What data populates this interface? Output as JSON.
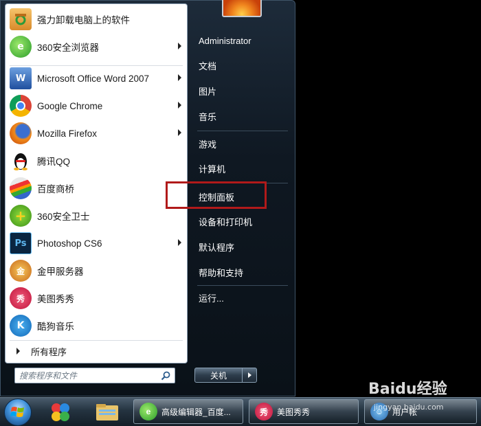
{
  "start_menu": {
    "programs": [
      {
        "label": "强力卸载电脑上的软件",
        "icon": "uninstall-box-icon",
        "has_submenu": false
      },
      {
        "label": "360安全浏览器",
        "icon": "360-browser-icon",
        "has_submenu": true
      },
      {
        "label": "Microsoft Office Word 2007",
        "icon": "word-icon",
        "has_submenu": true
      },
      {
        "label": "Google Chrome",
        "icon": "chrome-icon",
        "has_submenu": true
      },
      {
        "label": "Mozilla Firefox",
        "icon": "firefox-icon",
        "has_submenu": true
      },
      {
        "label": "腾讯QQ",
        "icon": "qq-penguin-icon",
        "has_submenu": false
      },
      {
        "label": "百度商桥",
        "icon": "baidu-shangqiao-icon",
        "has_submenu": false
      },
      {
        "label": "360安全卫士",
        "icon": "360-safe-guard-icon",
        "has_submenu": false
      },
      {
        "label": "Photoshop CS6",
        "icon": "photoshop-icon",
        "has_submenu": true
      },
      {
        "label": "金甲服务器",
        "icon": "jinjia-server-icon",
        "has_submenu": false
      },
      {
        "label": "美图秀秀",
        "icon": "meitu-icon",
        "has_submenu": false
      },
      {
        "label": "酷狗音乐",
        "icon": "kugou-icon",
        "has_submenu": false
      }
    ],
    "all_programs_label": "所有程序",
    "search_placeholder": "搜索程序和文件",
    "right_items": [
      {
        "label": "Administrator",
        "name": "user-name-link"
      },
      {
        "label": "文档",
        "name": "documents-link"
      },
      {
        "label": "图片",
        "name": "pictures-link"
      },
      {
        "label": "音乐",
        "name": "music-link"
      },
      {
        "label": "游戏",
        "name": "games-link"
      },
      {
        "label": "计算机",
        "name": "computer-link"
      },
      {
        "label": "控制面板",
        "name": "control-panel-link"
      },
      {
        "label": "设备和打印机",
        "name": "devices-printers-link"
      },
      {
        "label": "默认程序",
        "name": "default-programs-link"
      },
      {
        "label": "帮助和支持",
        "name": "help-support-link"
      },
      {
        "label": "运行...",
        "name": "run-link"
      }
    ],
    "shutdown_label": "关机"
  },
  "taskbar": {
    "buttons": [
      {
        "label": "高级编辑器_百度...",
        "icon": "360-browser-icon"
      },
      {
        "label": "美图秀秀",
        "icon": "meitu-icon"
      },
      {
        "label": "用户帐",
        "icon": "user-accounts-icon"
      }
    ]
  },
  "watermark": {
    "text": "Baidu经验",
    "subtext": "jingyan.baidu.com"
  },
  "colors": {
    "highlight": "#b11a1a",
    "menu_bg": "#0f1822"
  }
}
